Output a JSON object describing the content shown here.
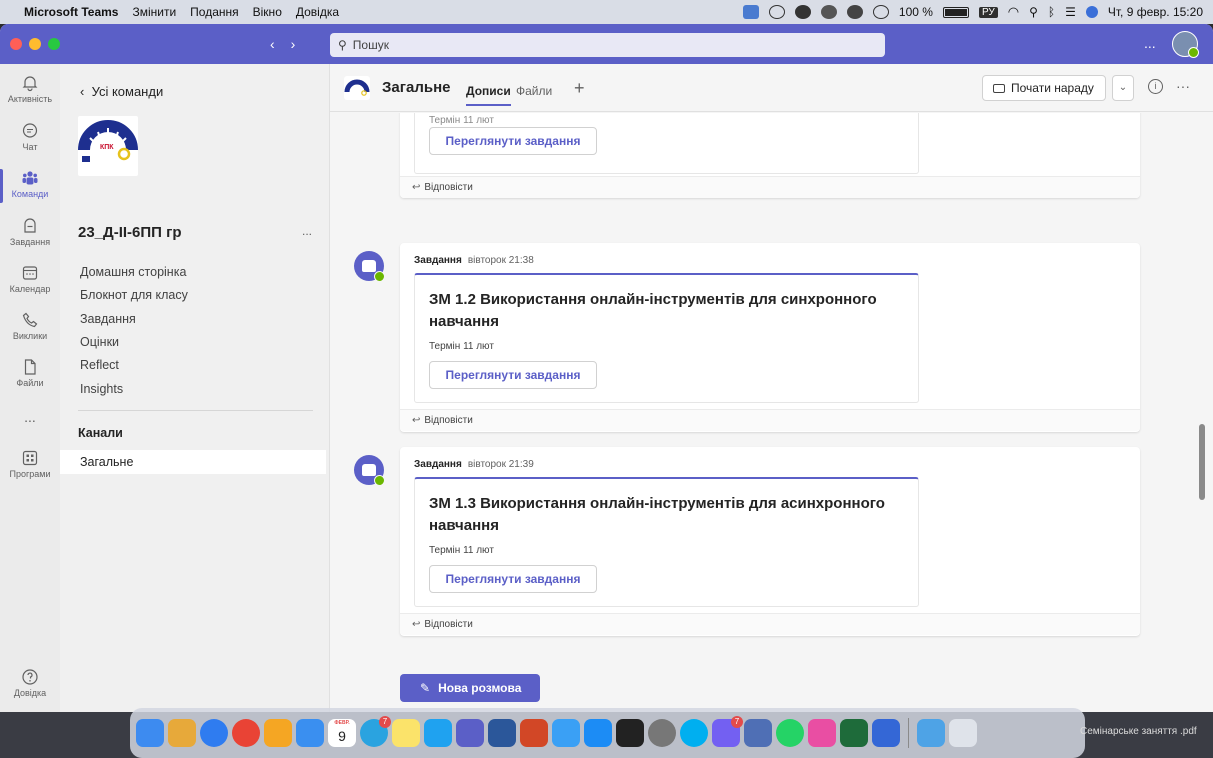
{
  "menubar": {
    "app": "Microsoft Teams",
    "menus": [
      "Змінити",
      "Подання",
      "Вікно",
      "Довідка"
    ],
    "battery": "100 %",
    "input_lang": "РУ",
    "clock": "Чт, 9 февр.  15:20"
  },
  "titlebar": {
    "search_placeholder": "Пошук",
    "more": "..."
  },
  "rail": {
    "items": [
      {
        "label": "Активність",
        "icon": "bell-icon"
      },
      {
        "label": "Чат",
        "icon": "chat-icon"
      },
      {
        "label": "Команди",
        "icon": "teams-icon"
      },
      {
        "label": "Завдання",
        "icon": "assignments-icon"
      },
      {
        "label": "Календар",
        "icon": "calendar-icon"
      },
      {
        "label": "Виклики",
        "icon": "phone-icon"
      },
      {
        "label": "Файли",
        "icon": "file-icon"
      },
      {
        "label": "...",
        "icon": "more-icon"
      },
      {
        "label": "Програми",
        "icon": "apps-icon"
      },
      {
        "label": "Довідка",
        "icon": "help-icon"
      }
    ]
  },
  "teampanel": {
    "back": "Усі команди",
    "logo_text": "КПК Фахова передвища освіта",
    "team_name": "23_Д-ІІ-6ПП гр",
    "team_more": "...",
    "nav": [
      "Домашня сторінка",
      "Блокнот для класу",
      "Завдання",
      "Оцінки",
      "Reflect",
      "Insights"
    ],
    "channels_header": "Канали",
    "channel": "Загальне"
  },
  "header": {
    "title": "Загальне",
    "tabs": [
      "Дописи",
      "Файли"
    ],
    "add_tab": "+",
    "meet_button": "Почати нараду",
    "meet_caret": "⌄",
    "info": "i",
    "more": "···"
  },
  "posts": [
    {
      "author": "",
      "time": "",
      "title": "",
      "due": "Термін 11 лют",
      "button": "Переглянути завдання",
      "reply": "Відповісти"
    },
    {
      "author": "Завдання",
      "time": "вівторок 21:38",
      "title": "ЗМ 1.2 Використання онлайн-інструментів для синхронного навчання",
      "due": "Термін 11 лют",
      "button": "Переглянути завдання",
      "reply": "Відповісти"
    },
    {
      "author": "Завдання",
      "time": "вівторок 21:39",
      "title": "ЗМ 1.3 Використання онлайн-інструментів для асинхронного навчання",
      "due": "Термін 11 лют",
      "button": "Переглянути завдання",
      "reply": "Відповісти"
    }
  ],
  "new_conversation": "Нова розмова",
  "dock": {
    "calendar_day": "9",
    "calendar_month": "ФЕВР.",
    "badge_telegram": "7",
    "badge_viber": "7",
    "desktop_file": "Семінарське заняття .pdf"
  },
  "colors": {
    "brand": "#5b5fc7",
    "presence": "#6bb700"
  }
}
